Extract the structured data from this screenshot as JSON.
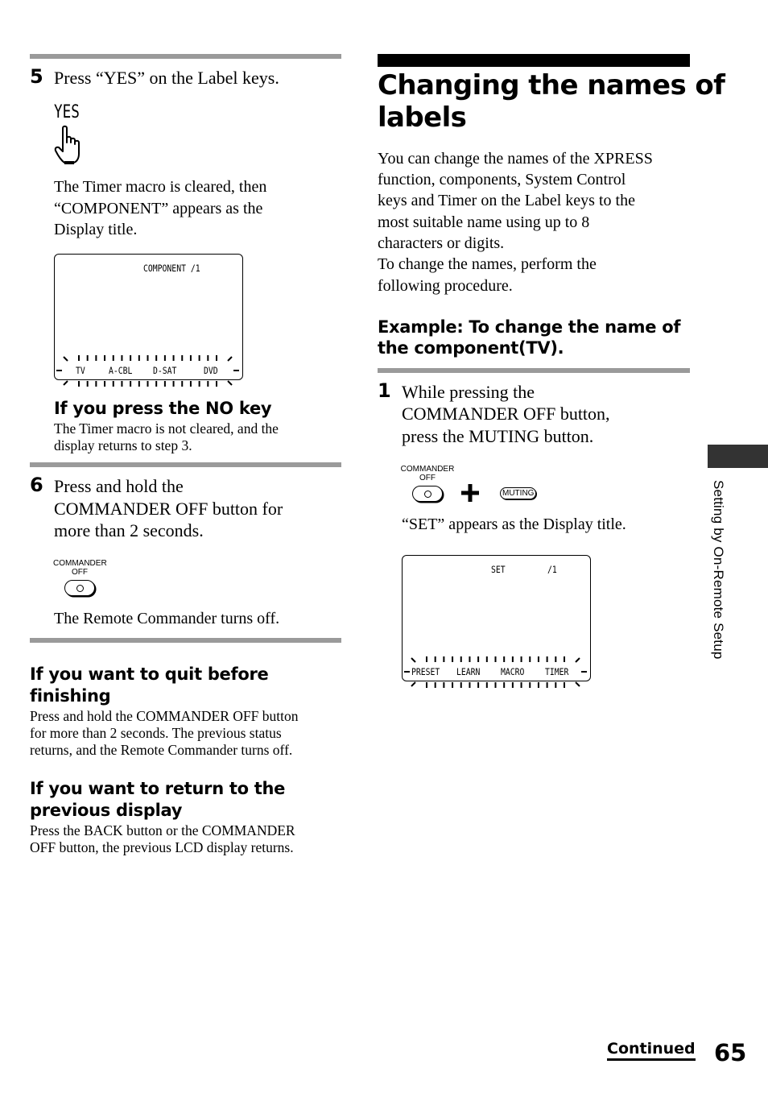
{
  "page": {
    "number": "65",
    "continued_label": "Continued",
    "side_tab_label": "Setting by On-Remote Setup"
  },
  "left_column": {
    "step5": {
      "number": "5",
      "text": "Press “YES” on the Label keys.",
      "key_label": "YES",
      "key_icon": "pointing-hand-icon",
      "result_lines": [
        "The Timer macro is cleared, then",
        "“COMPONENT” appears as the",
        "Display title."
      ],
      "lcd": {
        "title": "COMPONENT /1",
        "keys": [
          "TV",
          "A-CBL",
          "D-SAT",
          "DVD"
        ]
      },
      "note": {
        "heading": "If you press the NO key",
        "lines": [
          "The Timer macro is not cleared, and the",
          "display returns to step 3."
        ]
      }
    },
    "step6": {
      "number": "6",
      "text_lines": [
        "Press and hold the",
        "COMMANDER OFF button for",
        "more than 2 seconds."
      ],
      "button_label_lines": [
        "COMMANDER",
        "OFF"
      ],
      "button_icon": "circle-icon",
      "result": "The Remote Commander turns off."
    },
    "tip_quit": {
      "heading_lines": [
        "If you want to quit before",
        "finishing"
      ],
      "lines": [
        "Press and hold the COMMANDER OFF button",
        "for more than 2 seconds. The previous status",
        "returns, and the Remote Commander turns off."
      ]
    },
    "tip_return": {
      "heading_lines": [
        "If you want to return to the",
        "previous display"
      ],
      "lines": [
        "Press the BACK button or the COMMANDER",
        "OFF button, the previous LCD display returns."
      ]
    }
  },
  "right_column": {
    "title_lines": [
      "Changing the names of",
      "labels"
    ],
    "intro_lines": [
      "You can change the names of the XPRESS",
      "function, components, System Control",
      "keys and Timer on the Label keys to the",
      "most suitable name using up to 8",
      "characters or digits.",
      "To change the names, perform the",
      "following procedure."
    ],
    "example_heading_lines": [
      "Example: To change the name of",
      "the component(TV)."
    ],
    "step1": {
      "number": "1",
      "text_lines": [
        "While pressing the",
        "COMMANDER OFF button,",
        "press the MUTING button."
      ],
      "button_label_lines": [
        "COMMANDER",
        "OFF"
      ],
      "plus_symbol": "+",
      "muting_label": "MUTING",
      "result": "“SET” appears as the Display title.",
      "lcd": {
        "title": "SET",
        "page": "/1",
        "keys": [
          "PRESET",
          "LEARN",
          "MACRO",
          "TIMER"
        ]
      }
    }
  },
  "colors": {
    "rule_gray": "#9a9a9a",
    "rule_black": "#000000",
    "side_tab": "#333333"
  }
}
